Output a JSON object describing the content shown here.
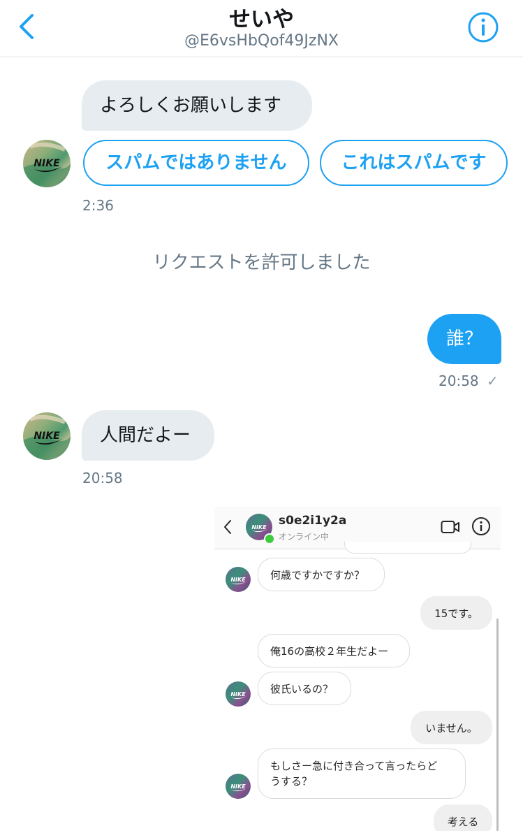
{
  "header": {
    "name": "せいや",
    "handle": "@E6vsHbQof49JzNX"
  },
  "messages": {
    "greeting": "よろしくお願いします",
    "not_spam_button": "スパムではありません",
    "is_spam_button": "これはスパムです",
    "greeting_time": "2:36",
    "system_notice": "リクエストを許可しました",
    "sent_text": "誰？",
    "sent_time": "20:58",
    "sent_status": "✓",
    "reply_text": "人間だよー",
    "reply_time": "20:58"
  },
  "avatar_logo": "NIKE",
  "embedded_chat": {
    "username": "s0e2i1y2a",
    "status": "オンライン中",
    "messages": [
      {
        "side": "in",
        "text": "何歳ですかですか？"
      },
      {
        "side": "out",
        "text": "15です。"
      },
      {
        "side": "in",
        "text": "俺16の高校２年生だよー"
      },
      {
        "side": "in",
        "text": "彼氏いるの？"
      },
      {
        "side": "out",
        "text": "いません。"
      },
      {
        "side": "in",
        "text_line1": "もしさー急に付き合って言ったらど",
        "text_line2": "うする？"
      },
      {
        "side": "out",
        "text": "考える"
      }
    ]
  },
  "colors": {
    "accent": "#1da1f2",
    "incoming_bubble": "#e6ecf0",
    "muted_text": "#657786",
    "online_dot": "#3ecb3e"
  },
  "icons": [
    "back-chevron-icon",
    "info-icon",
    "video-call-icon",
    "online-status-dot-icon"
  ]
}
